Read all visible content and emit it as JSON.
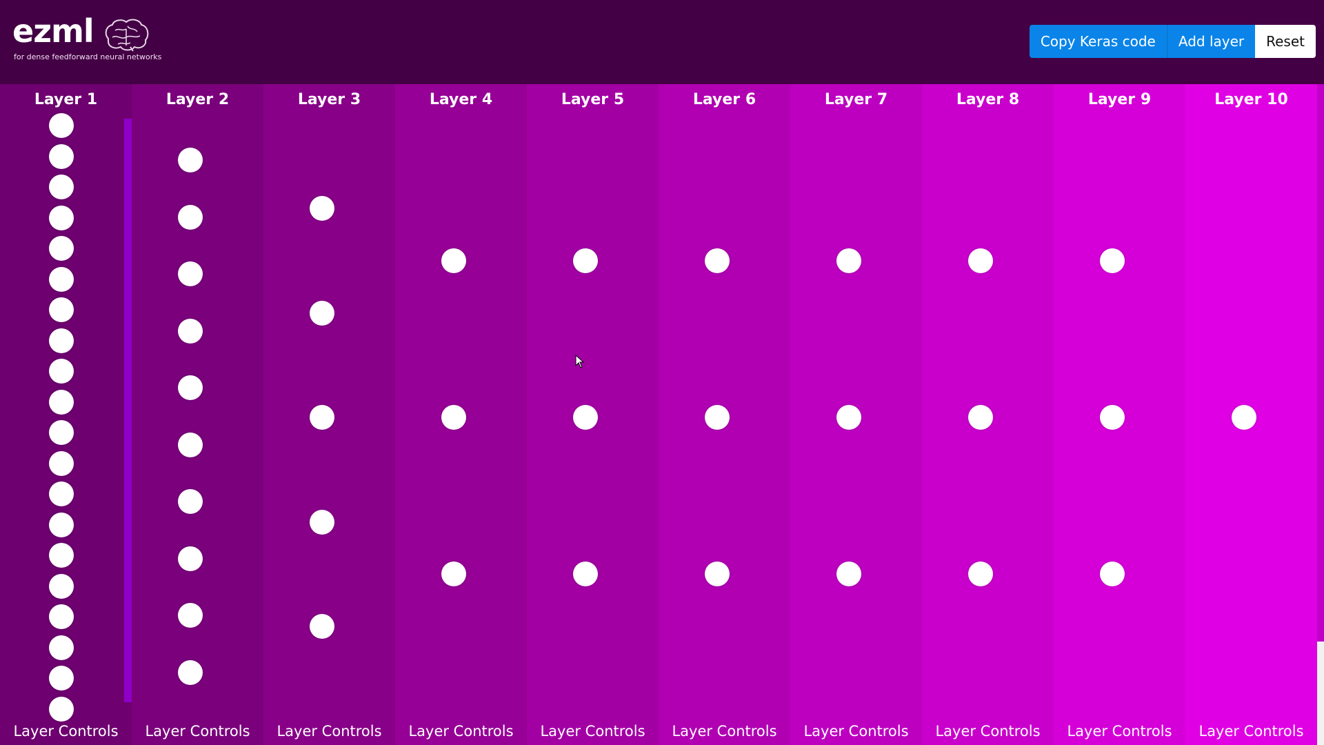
{
  "header": {
    "logo_text": "ezml",
    "tagline": "for dense feedforward neural networks",
    "brain_icon": "brain-icon",
    "buttons": {
      "copy": "Copy Keras code",
      "add": "Add layer",
      "reset": "Reset"
    }
  },
  "colors": {
    "header_bg": "#430044",
    "button_blue": "#0a84e8",
    "column_gradient": [
      "#6e0070",
      "#7a007c",
      "#880088",
      "#960096",
      "#a300a4",
      "#b000b2",
      "#bd00c0",
      "#c900cc",
      "#d500d8",
      "#e000e4"
    ],
    "node": "#ffffff"
  },
  "layers": [
    {
      "title": "Layer 1",
      "controls": "Layer Controls",
      "node_count": 20
    },
    {
      "title": "Layer 2",
      "controls": "Layer Controls",
      "node_count": 10
    },
    {
      "title": "Layer 3",
      "controls": "Layer Controls",
      "node_count": 5
    },
    {
      "title": "Layer 4",
      "controls": "Layer Controls",
      "node_count": 3
    },
    {
      "title": "Layer 5",
      "controls": "Layer Controls",
      "node_count": 3
    },
    {
      "title": "Layer 6",
      "controls": "Layer Controls",
      "node_count": 3
    },
    {
      "title": "Layer 7",
      "controls": "Layer Controls",
      "node_count": 3
    },
    {
      "title": "Layer 8",
      "controls": "Layer Controls",
      "node_count": 3
    },
    {
      "title": "Layer 9",
      "controls": "Layer Controls",
      "node_count": 3
    },
    {
      "title": "Layer 10",
      "controls": "Layer Controls",
      "node_count": 1
    }
  ]
}
